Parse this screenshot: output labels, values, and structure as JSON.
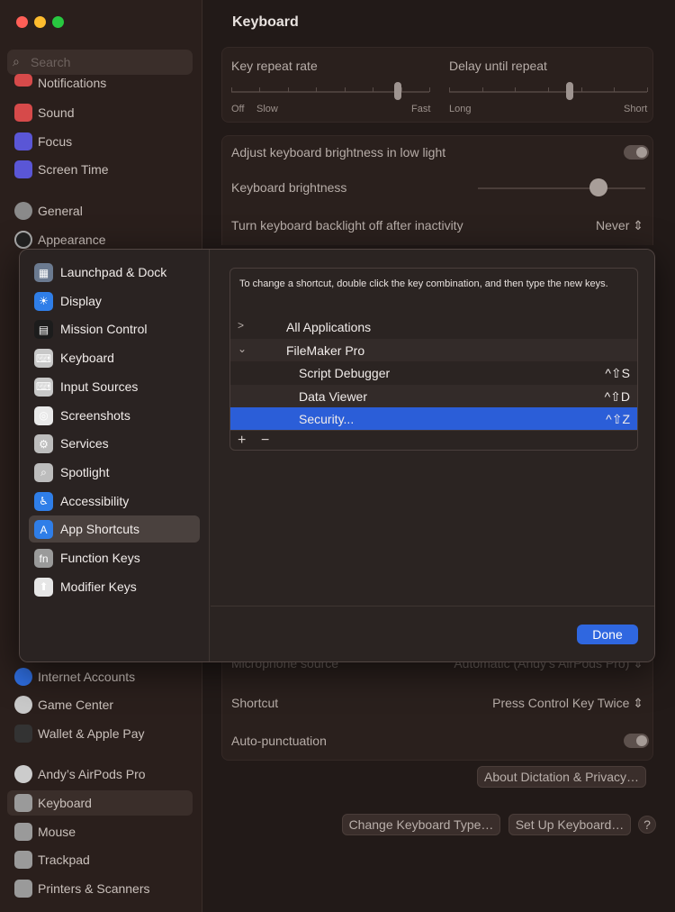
{
  "window": {
    "title": "Keyboard",
    "traffic_colors": [
      "#ff5f57",
      "#febc2e",
      "#28c840"
    ]
  },
  "search": {
    "placeholder": "Search"
  },
  "sidebar": {
    "items": [
      {
        "label": "Notifications",
        "icon": "bell-icon",
        "color": "#d64a4a"
      },
      {
        "label": "Sound",
        "icon": "speaker-icon",
        "color": "#d64a4a"
      },
      {
        "label": "Focus",
        "icon": "moon-icon",
        "color": "#5a56d6"
      },
      {
        "label": "Screen Time",
        "icon": "hourglass-icon",
        "color": "#5a56d6"
      },
      {
        "label": "General",
        "icon": "gear-icon",
        "color": "#8a8a8a"
      },
      {
        "label": "Appearance",
        "icon": "appearance-icon",
        "color": "#222222"
      },
      {
        "label": "Internet Accounts",
        "icon": "at-icon",
        "color": "#2f6ee0"
      },
      {
        "label": "Game Center",
        "icon": "game-center-icon",
        "color": "#c9c9c9"
      },
      {
        "label": "Wallet & Apple Pay",
        "icon": "wallet-icon",
        "color": "#333333"
      },
      {
        "label": "Andy’s AirPods Pro",
        "icon": "airpods-icon",
        "color": "#cccccc"
      },
      {
        "label": "Keyboard",
        "icon": "keyboard-icon",
        "color": "#9a9a9a"
      },
      {
        "label": "Mouse",
        "icon": "mouse-icon",
        "color": "#9a9a9a"
      },
      {
        "label": "Trackpad",
        "icon": "trackpad-icon",
        "color": "#9a9a9a"
      },
      {
        "label": "Printers & Scanners",
        "icon": "printer-icon",
        "color": "#9a9a9a"
      }
    ]
  },
  "keyboard": {
    "key_repeat": {
      "label": "Key repeat rate",
      "left": "Off",
      "left2": "Slow",
      "right": "Fast",
      "value_fraction": 0.84
    },
    "delay": {
      "label": "Delay until repeat",
      "left": "Long",
      "right": "Short",
      "value_fraction": 0.61
    },
    "adjust_brightness": "Adjust keyboard brightness in low light",
    "brightness_label": "Keyboard brightness",
    "brightness_fraction": 0.72,
    "backlight_off": "Turn keyboard backlight off after inactivity",
    "backlight_value": "Never"
  },
  "dictation": {
    "mic_source_label": "Microphone source",
    "mic_source_value": "Automatic (Andy’s AirPods Pro)",
    "shortcut_label": "Shortcut",
    "shortcut_value": "Press Control Key Twice",
    "autopunct_label": "Auto-punctuation",
    "about_button": "About Dictation & Privacy…",
    "change_type_button": "Change Keyboard Type…",
    "setup_button": "Set Up Keyboard…",
    "help": "?"
  },
  "modal": {
    "nav": [
      {
        "label": "Launchpad & Dock",
        "icon": "launchpad-icon",
        "color": "#6b7a90",
        "glyph": "▦"
      },
      {
        "label": "Display",
        "icon": "display-icon",
        "color": "#2f7ee8",
        "glyph": "☀"
      },
      {
        "label": "Mission Control",
        "icon": "mission-control-icon",
        "color": "#1c1c1c",
        "glyph": "▤"
      },
      {
        "label": "Keyboard",
        "icon": "keyboard-icon",
        "color": "#c8c8c8",
        "glyph": "⌨"
      },
      {
        "label": "Input Sources",
        "icon": "input-sources-icon",
        "color": "#c8c8c8",
        "glyph": "⌨"
      },
      {
        "label": "Screenshots",
        "icon": "screenshot-icon",
        "color": "#e9e9e9",
        "glyph": "◎"
      },
      {
        "label": "Services",
        "icon": "services-icon",
        "color": "#bdbdbd",
        "glyph": "⚙"
      },
      {
        "label": "Spotlight",
        "icon": "spotlight-icon",
        "color": "#bdbdbd",
        "glyph": "⌕"
      },
      {
        "label": "Accessibility",
        "icon": "accessibility-icon",
        "color": "#2f7ee8",
        "glyph": "♿"
      },
      {
        "label": "App Shortcuts",
        "icon": "app-store-icon",
        "color": "#2f7ee8",
        "glyph": "A"
      },
      {
        "label": "Function Keys",
        "icon": "fn-icon",
        "color": "#9a9a9a",
        "glyph": "fn"
      },
      {
        "label": "Modifier Keys",
        "icon": "modifier-icon",
        "color": "#e6e6e6",
        "glyph": "⬆"
      }
    ],
    "selected_index": 9,
    "instruction": "To change a shortcut, double click the key combination, and then type the new keys.",
    "tree": [
      {
        "chevron": ">",
        "name": "All Applications",
        "key": "",
        "indent": 0
      },
      {
        "chevron": "⌄",
        "name": "FileMaker Pro",
        "key": "",
        "indent": 0
      },
      {
        "chevron": "",
        "name": "Script Debugger",
        "key": "^⇧S",
        "indent": 1
      },
      {
        "chevron": "",
        "name": "Data Viewer",
        "key": "^⇧D",
        "indent": 1
      },
      {
        "chevron": "",
        "name": "Security...",
        "key": "^⇧Z",
        "indent": 1
      }
    ],
    "highlighted_row": 4,
    "add": "+",
    "remove": "−",
    "done": "Done"
  }
}
